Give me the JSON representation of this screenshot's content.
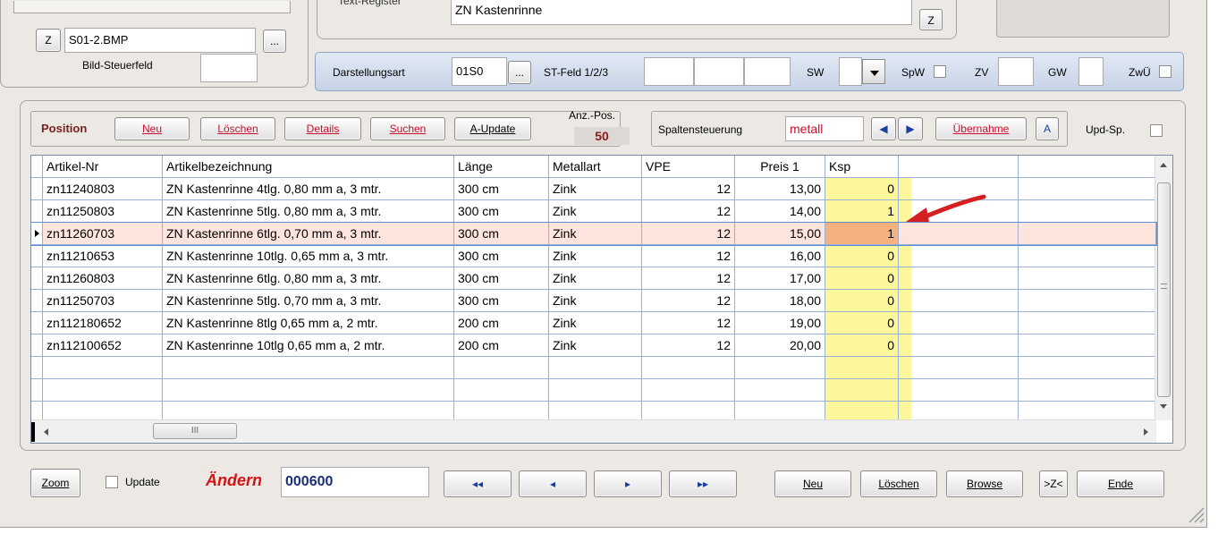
{
  "top": {
    "z_label": "Z",
    "bild_file": "S01-2.BMP",
    "browse_dots": "...",
    "bild_steuerfeld_label": "Bild-Steuerfeld",
    "text_register_label": "Text-Register",
    "text_register_value": "ZN Kastenrinne",
    "z2_label": "Z"
  },
  "darstellung": {
    "label": "Darstellungsart",
    "value": "01S0",
    "dots": "...",
    "st_feld_label": "ST-Feld 1/2/3",
    "sw_label": "SW",
    "spw_label": "SpW",
    "zv_label": "ZV",
    "gw_label": "GW",
    "zwu_label": "ZwÜ"
  },
  "position_bar": {
    "title": "Position",
    "neu": "Neu",
    "loeschen": "Löschen",
    "details": "Details",
    "suchen": "Suchen",
    "a_update": "A-Update",
    "anz_pos_label": "Anz.-Pos.",
    "anz_pos_value": "50",
    "spaltensteuerung_label": "Spaltensteuerung",
    "spaltensteuerung_value": "metall",
    "uebernahme": "Übernahme",
    "a_btn": "A",
    "upd_sp_label": "Upd-Sp."
  },
  "table": {
    "columns": [
      "Artikel-Nr",
      "Artikelbezeichnung",
      "Länge",
      "Metallart",
      "VPE",
      "Preis 1",
      "Ksp"
    ],
    "rows": [
      [
        "zn11240803",
        "ZN Kastenrinne  4tlg. 0,80 mm a, 3 mtr.",
        "300 cm",
        "Zink",
        "12",
        "13,00",
        "0"
      ],
      [
        "zn11250803",
        "ZN Kastenrinne  5tlg. 0,80 mm a, 3 mtr.",
        "300 cm",
        "Zink",
        "12",
        "14,00",
        "1"
      ],
      [
        "zn11260703",
        "ZN Kastenrinne  6tlg. 0,70 mm a, 3 mtr.",
        "300 cm",
        "Zink",
        "12",
        "15,00",
        "1"
      ],
      [
        "zn11210653",
        "ZN Kastenrinne 10tlg. 0,65 mm a, 3 mtr.",
        "300 cm",
        "Zink",
        "12",
        "16,00",
        "0"
      ],
      [
        "zn11260803",
        "ZN Kastenrinne  6tlg. 0,80 mm a, 3 mtr.",
        "300 cm",
        "Zink",
        "12",
        "17,00",
        "0"
      ],
      [
        "zn11250703",
        "ZN Kastenrinne  5tlg. 0,70 mm a, 3 mtr.",
        "300 cm",
        "Zink",
        "12",
        "18,00",
        "0"
      ],
      [
        "zn112180652",
        "ZN Kastenrinne  8tlg 0,65 mm a, 2 mtr.",
        "200 cm",
        "Zink",
        "12",
        "19,00",
        "0"
      ],
      [
        "zn112100652",
        "ZN Kastenrinne 10tlg 0,65 mm a, 2 mtr.",
        "200 cm",
        "Zink",
        "12",
        "20,00",
        "0"
      ]
    ],
    "selected_row": 2,
    "highlight_color": "#fbf68a"
  },
  "bottom": {
    "zoom": "Zoom",
    "update_label": "Update",
    "mode": "Ändern",
    "record": "000600",
    "first": "◂◂",
    "prev": "◂",
    "next": "▸",
    "last": "▸▸",
    "neu": "Neu",
    "loeschen": "Löschen",
    "browse": "Browse",
    "zx": ">Z<",
    "ende": "Ende"
  },
  "scroll_marker": "III"
}
